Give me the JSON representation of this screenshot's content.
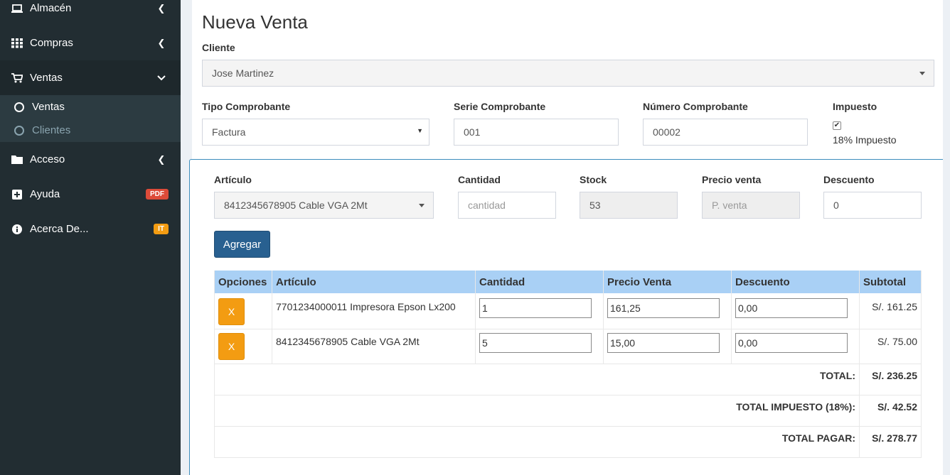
{
  "sidebar": {
    "items": [
      {
        "label": "Almacén",
        "icon": "laptop-icon"
      },
      {
        "label": "Compras",
        "icon": "grid-icon"
      },
      {
        "label": "Ventas",
        "icon": "cart-icon"
      },
      {
        "label": "Acceso",
        "icon": "folder-icon"
      },
      {
        "label": "Ayuda",
        "icon": "plus-square-icon",
        "badge": "PDF",
        "badge_color": "#dd4b39"
      },
      {
        "label": "Acerca De...",
        "icon": "info-icon",
        "badge": "IT",
        "badge_color": "#f39c12"
      }
    ],
    "sub_items": [
      {
        "label": "Ventas"
      },
      {
        "label": "Clientes"
      }
    ]
  },
  "form": {
    "title": "Nueva Venta",
    "cliente_label": "Cliente",
    "cliente_value": "Jose Martinez",
    "tipo_label": "Tipo Comprobante",
    "tipo_value": "Factura",
    "serie_label": "Serie Comprobante",
    "serie_value": "001",
    "numero_label": "Número Comprobante",
    "numero_value": "00002",
    "impuesto_label": "Impuesto",
    "impuesto_checkbox_label": "18% Impuesto",
    "impuesto_checked": true
  },
  "detail": {
    "articulo_label": "Artículo",
    "articulo_value": "8412345678905 Cable VGA 2Mt",
    "cantidad_label": "Cantidad",
    "cantidad_placeholder": "cantidad",
    "stock_label": "Stock",
    "stock_value": "53",
    "precio_label": "Precio venta",
    "precio_placeholder": "P. venta",
    "descuento_label": "Descuento",
    "descuento_value": "0",
    "agregar_label": "Agregar"
  },
  "table": {
    "headers": [
      "Opciones",
      "Artículo",
      "Cantidad",
      "Precio Venta",
      "Descuento",
      "Subtotal"
    ],
    "rows": [
      {
        "remove": "X",
        "articulo": "7701234000011 Impresora Epson Lx200",
        "cantidad": "1",
        "precio": "161,25",
        "descuento": "0,00",
        "subtotal": "S/. 161.25"
      },
      {
        "remove": "X",
        "articulo": "8412345678905 Cable VGA 2Mt",
        "cantidad": "5",
        "precio": "15,00",
        "descuento": "0,00",
        "subtotal": "S/. 75.00"
      }
    ],
    "totals": [
      {
        "label": "TOTAL:",
        "value": "S/. 236.25"
      },
      {
        "label": "TOTAL IMPUESTO (18%):",
        "value": "S/. 42.52"
      },
      {
        "label": "TOTAL PAGAR:",
        "value": "S/. 278.77"
      }
    ]
  },
  "colors": {
    "sidebar_bg": "#222d32",
    "table_header": "#a9d0f5",
    "primary_button": "#286090",
    "remove_button": "#f39c12"
  }
}
